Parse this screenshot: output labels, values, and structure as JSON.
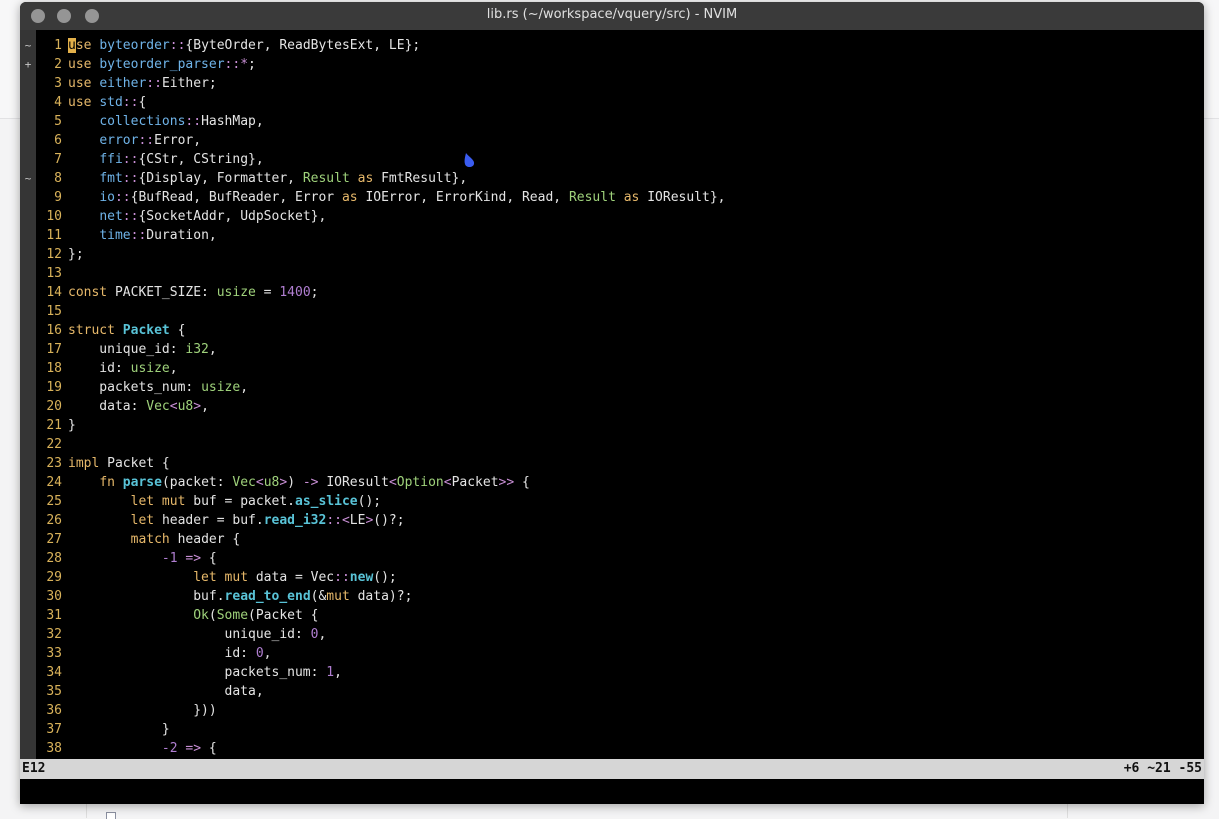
{
  "window": {
    "title": "lib.rs (~/workspace/vquery/src) - NVIM"
  },
  "signs": [
    {
      "line": 1,
      "text": "~"
    },
    {
      "line": 2,
      "text": "+"
    },
    {
      "line": 8,
      "text": "~"
    }
  ],
  "code_lines": [
    {
      "n": "1",
      "t": [
        [
          "cursor",
          "u"
        ],
        [
          "kw",
          "se "
        ],
        [
          "mod",
          "byteorder"
        ],
        [
          "op",
          "::"
        ],
        [
          "pl",
          "{ByteOrder, ReadBytesExt, LE};"
        ]
      ]
    },
    {
      "n": "2",
      "t": [
        [
          "kw",
          "use "
        ],
        [
          "mod",
          "byteorder_parser"
        ],
        [
          "op",
          "::*"
        ],
        [
          "pl",
          ";"
        ]
      ]
    },
    {
      "n": "3",
      "t": [
        [
          "kw",
          "use "
        ],
        [
          "mod",
          "either"
        ],
        [
          "op",
          "::"
        ],
        [
          "pl",
          "Either;"
        ]
      ]
    },
    {
      "n": "4",
      "t": [
        [
          "kw",
          "use "
        ],
        [
          "mod",
          "std"
        ],
        [
          "op",
          "::"
        ],
        [
          "pl",
          "{"
        ]
      ]
    },
    {
      "n": "5",
      "t": [
        [
          "pl",
          "    "
        ],
        [
          "mod",
          "collections"
        ],
        [
          "op",
          "::"
        ],
        [
          "pl",
          "HashMap,"
        ]
      ]
    },
    {
      "n": "6",
      "t": [
        [
          "pl",
          "    "
        ],
        [
          "mod",
          "error"
        ],
        [
          "op",
          "::"
        ],
        [
          "pl",
          "Error,"
        ]
      ]
    },
    {
      "n": "7",
      "t": [
        [
          "pl",
          "    "
        ],
        [
          "mod",
          "ffi"
        ],
        [
          "op",
          "::"
        ],
        [
          "pl",
          "{CStr, CString},"
        ]
      ]
    },
    {
      "n": "8",
      "t": [
        [
          "pl",
          "    "
        ],
        [
          "mod",
          "fmt"
        ],
        [
          "op",
          "::"
        ],
        [
          "pl",
          "{Display, Formatter, "
        ],
        [
          "ty",
          "Result"
        ],
        [
          "kw",
          " as "
        ],
        [
          "pl",
          "FmtResult},"
        ]
      ]
    },
    {
      "n": "9",
      "t": [
        [
          "pl",
          "    "
        ],
        [
          "mod",
          "io"
        ],
        [
          "op",
          "::"
        ],
        [
          "pl",
          "{BufRead, BufReader, Error "
        ],
        [
          "kw",
          "as "
        ],
        [
          "pl",
          "IOError, ErrorKind, Read, "
        ],
        [
          "ty",
          "Result"
        ],
        [
          "kw",
          " as "
        ],
        [
          "pl",
          "IOResult},"
        ]
      ]
    },
    {
      "n": "10",
      "t": [
        [
          "pl",
          "    "
        ],
        [
          "mod",
          "net"
        ],
        [
          "op",
          "::"
        ],
        [
          "pl",
          "{SocketAddr, UdpSocket},"
        ]
      ]
    },
    {
      "n": "11",
      "t": [
        [
          "pl",
          "    "
        ],
        [
          "mod",
          "time"
        ],
        [
          "op",
          "::"
        ],
        [
          "pl",
          "Duration,"
        ]
      ]
    },
    {
      "n": "12",
      "t": [
        [
          "pl",
          "};"
        ]
      ]
    },
    {
      "n": "13",
      "t": []
    },
    {
      "n": "14",
      "t": [
        [
          "kw",
          "const "
        ],
        [
          "pl",
          "PACKET_SIZE: "
        ],
        [
          "ty",
          "usize"
        ],
        [
          "pl",
          " = "
        ],
        [
          "num",
          "1400"
        ],
        [
          "pl",
          ";"
        ]
      ]
    },
    {
      "n": "15",
      "t": []
    },
    {
      "n": "16",
      "t": [
        [
          "kw",
          "struct "
        ],
        [
          "fn",
          "Packet"
        ],
        [
          "pl",
          " {"
        ]
      ]
    },
    {
      "n": "17",
      "t": [
        [
          "pl",
          "    unique_id: "
        ],
        [
          "ty",
          "i32"
        ],
        [
          "pl",
          ","
        ]
      ]
    },
    {
      "n": "18",
      "t": [
        [
          "pl",
          "    id: "
        ],
        [
          "ty",
          "usize"
        ],
        [
          "pl",
          ","
        ]
      ]
    },
    {
      "n": "19",
      "t": [
        [
          "pl",
          "    packets_num: "
        ],
        [
          "ty",
          "usize"
        ],
        [
          "pl",
          ","
        ]
      ]
    },
    {
      "n": "20",
      "t": [
        [
          "pl",
          "    data: "
        ],
        [
          "ty",
          "Vec"
        ],
        [
          "op",
          "<"
        ],
        [
          "ty",
          "u8"
        ],
        [
          "op",
          ">"
        ],
        [
          "pl",
          ","
        ]
      ]
    },
    {
      "n": "21",
      "t": [
        [
          "pl",
          "}"
        ]
      ]
    },
    {
      "n": "22",
      "t": []
    },
    {
      "n": "23",
      "t": [
        [
          "kw",
          "impl "
        ],
        [
          "pl",
          "Packet {"
        ]
      ]
    },
    {
      "n": "24",
      "t": [
        [
          "pl",
          "    "
        ],
        [
          "kw",
          "fn "
        ],
        [
          "fn",
          "parse"
        ],
        [
          "pl",
          "(packet: "
        ],
        [
          "ty",
          "Vec"
        ],
        [
          "op",
          "<"
        ],
        [
          "ty",
          "u8"
        ],
        [
          "op",
          ">"
        ],
        [
          "pl",
          ") "
        ],
        [
          "op",
          "->"
        ],
        [
          "pl",
          " IOResult"
        ],
        [
          "op",
          "<"
        ],
        [
          "ty",
          "Option"
        ],
        [
          "op",
          "<"
        ],
        [
          "pl",
          "Packet"
        ],
        [
          "op",
          ">>"
        ],
        [
          "pl",
          " {"
        ]
      ]
    },
    {
      "n": "25",
      "t": [
        [
          "pl",
          "        "
        ],
        [
          "kw",
          "let mut "
        ],
        [
          "pl",
          "buf = packet."
        ],
        [
          "fn",
          "as_slice"
        ],
        [
          "pl",
          "();"
        ]
      ]
    },
    {
      "n": "26",
      "t": [
        [
          "pl",
          "        "
        ],
        [
          "kw",
          "let "
        ],
        [
          "pl",
          "header = buf."
        ],
        [
          "fn",
          "read_i32"
        ],
        [
          "op",
          "::<"
        ],
        [
          "pl",
          "LE"
        ],
        [
          "op",
          ">"
        ],
        [
          "pl",
          "()?;"
        ]
      ]
    },
    {
      "n": "27",
      "t": [
        [
          "pl",
          "        "
        ],
        [
          "kw",
          "match "
        ],
        [
          "pl",
          "header {"
        ]
      ]
    },
    {
      "n": "28",
      "t": [
        [
          "pl",
          "            "
        ],
        [
          "num",
          "-1"
        ],
        [
          "op",
          " =>"
        ],
        [
          "pl",
          " {"
        ]
      ]
    },
    {
      "n": "29",
      "t": [
        [
          "pl",
          "                "
        ],
        [
          "kw",
          "let mut "
        ],
        [
          "pl",
          "data = Vec"
        ],
        [
          "op",
          "::"
        ],
        [
          "fn",
          "new"
        ],
        [
          "pl",
          "();"
        ]
      ]
    },
    {
      "n": "30",
      "t": [
        [
          "pl",
          "                buf."
        ],
        [
          "fn",
          "read_to_end"
        ],
        [
          "pl",
          "(&"
        ],
        [
          "kw",
          "mut "
        ],
        [
          "pl",
          "data)?;"
        ]
      ]
    },
    {
      "n": "31",
      "t": [
        [
          "pl",
          "                "
        ],
        [
          "ty",
          "Ok"
        ],
        [
          "pl",
          "("
        ],
        [
          "ty",
          "Some"
        ],
        [
          "pl",
          "(Packet {"
        ]
      ]
    },
    {
      "n": "32",
      "t": [
        [
          "pl",
          "                    unique_id: "
        ],
        [
          "num",
          "0"
        ],
        [
          "pl",
          ","
        ]
      ]
    },
    {
      "n": "33",
      "t": [
        [
          "pl",
          "                    id: "
        ],
        [
          "num",
          "0"
        ],
        [
          "pl",
          ","
        ]
      ]
    },
    {
      "n": "34",
      "t": [
        [
          "pl",
          "                    packets_num: "
        ],
        [
          "num",
          "1"
        ],
        [
          "pl",
          ","
        ]
      ]
    },
    {
      "n": "35",
      "t": [
        [
          "pl",
          "                    data,"
        ]
      ]
    },
    {
      "n": "36",
      "t": [
        [
          "pl",
          "                }))"
        ]
      ]
    },
    {
      "n": "37",
      "t": [
        [
          "pl",
          "            }"
        ]
      ]
    },
    {
      "n": "38",
      "t": [
        [
          "pl",
          "            "
        ],
        [
          "num",
          "-2"
        ],
        [
          "op",
          " =>"
        ],
        [
          "pl",
          " {"
        ]
      ]
    }
  ],
  "statusbar": {
    "left": "E12",
    "right": "+6 ~21 -55"
  },
  "colors": {
    "keyword": "#e6b86a",
    "module": "#6fb3e8",
    "type": "#9fd27b",
    "function": "#59c3d7",
    "number": "#b07ed1",
    "line_number": "#d9b25a",
    "drop_icon": "#3a5cf0"
  },
  "icons": {
    "drop": "water-drop-icon"
  }
}
